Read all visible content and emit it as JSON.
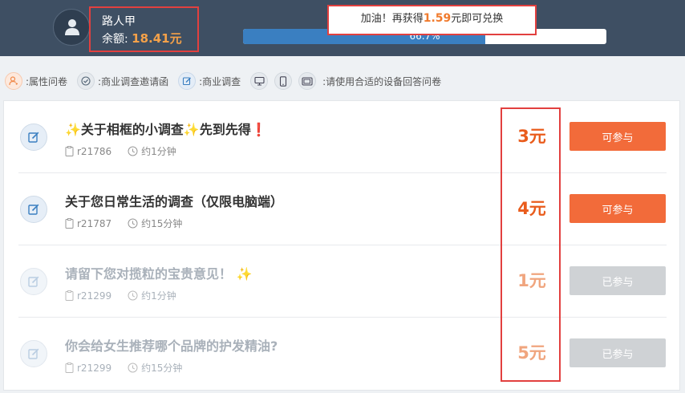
{
  "user": {
    "name": "路人甲",
    "balance_label": "余额:",
    "balance_amount": "18.41元"
  },
  "progress": {
    "hint_prefix": "加油！再获得",
    "hint_amount": "1.59",
    "hint_suffix": "元即可兑换",
    "percent": 66.7,
    "percent_text": "66.7%"
  },
  "legend": {
    "attribute": ":属性问卷",
    "invitation": ":商业调查邀请函",
    "commercial": ":商业调查",
    "device_hint": ":请使用合适的设备回答问卷"
  },
  "surveys": [
    {
      "title": "✨关于相框的小调查✨先到先得❗",
      "id": "r21786",
      "duration": "约1分钟",
      "reward": "3元",
      "button": "可参与",
      "status": "available"
    },
    {
      "title": "关于您日常生活的调查（仅限电脑端）",
      "id": "r21787",
      "duration": "约15分钟",
      "reward": "4元",
      "button": "可参与",
      "status": "available"
    },
    {
      "title": "请留下您对揽粒的宝贵意见！ ✨",
      "id": "r21299",
      "duration": "约1分钟",
      "reward": "1元",
      "button": "已参与",
      "status": "done"
    },
    {
      "title": "你会给女生推荐哪个品牌的护发精油?",
      "id": "r21299",
      "duration": "约15分钟",
      "reward": "5元",
      "button": "已参与",
      "status": "done"
    }
  ],
  "colors": {
    "header_bg": "#3e4f63",
    "accent_orange": "#f26b3a",
    "reward_orange": "#e95c1c",
    "progress_blue": "#3a7fc1",
    "highlight_red": "#e2403f",
    "disabled_gray": "#cfd2d5"
  },
  "icons": {
    "avatar": "user-icon",
    "attribute": "person-icon",
    "invitation": "check-circle-icon",
    "commercial": "edit-icon",
    "desktop": "monitor-icon",
    "mobile": "phone-icon",
    "tablet": "tablet-icon",
    "row": "edit-icon",
    "id": "clipboard-icon",
    "time": "clock-icon"
  }
}
